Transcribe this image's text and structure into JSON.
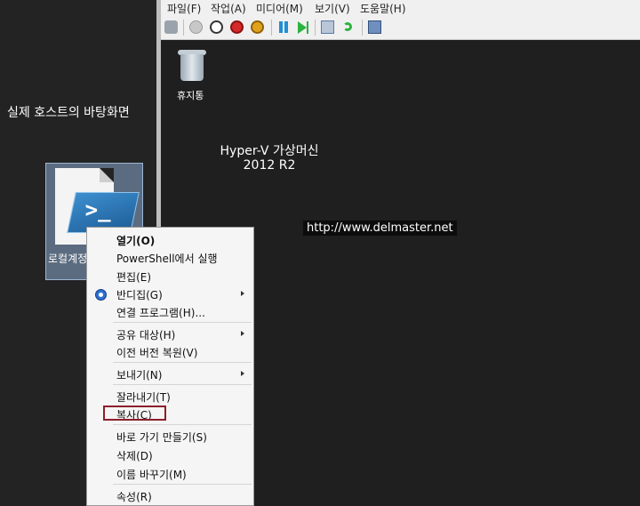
{
  "host": {
    "label": "실제 호스트의 바탕화면",
    "icon_label": "로컬계정"
  },
  "vm": {
    "menu": [
      "파일(F)",
      "작업(A)",
      "미디어(M)",
      "보기(V)",
      "도움말(H)"
    ],
    "recycle_bin_label": "휴지통",
    "title_line1": "Hyper-V 가상머신",
    "title_line2": "2012 R2",
    "url": "http://www.delmaster.net"
  },
  "context_menu": {
    "items": [
      "열기(O)",
      "PowerShell에서 실행",
      "편집(E)",
      "반디집(G)",
      "연결 프로그램(H)...",
      "공유 대상(H)",
      "이전 버전 복원(V)",
      "보내기(N)",
      "잘라내기(T)",
      "복사(C)",
      "바로 가기 만들기(S)",
      "삭제(D)",
      "이름 바꾸기(M)",
      "속성(R)"
    ]
  },
  "colors": {
    "highlight_border": "#8b1f2a",
    "desktop_bg": "#232323",
    "menu_bg": "#f5f5f5"
  }
}
